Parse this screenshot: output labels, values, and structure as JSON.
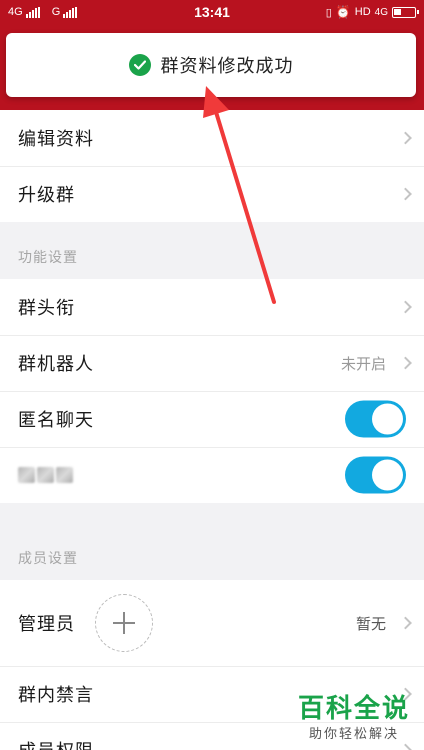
{
  "status_bar": {
    "sim1": "4G",
    "sim2": "G",
    "time": "13:41",
    "right_label": "HD",
    "right_net": "4G"
  },
  "toast": {
    "text": "群资料修改成功",
    "icon": "check-circle-icon"
  },
  "profile_section": {
    "items": [
      {
        "label": "编辑资料"
      },
      {
        "label": "升级群"
      }
    ]
  },
  "function_section": {
    "title": "功能设置",
    "items": [
      {
        "label": "群头衔",
        "value": ""
      },
      {
        "label": "群机器人",
        "value": "未开启"
      },
      {
        "label": "匿名聊天",
        "toggle_on": true
      },
      {
        "label": "",
        "toggle_on": true
      }
    ]
  },
  "member_section": {
    "title": "成员设置",
    "items": [
      {
        "label": "管理员",
        "value": "暂无"
      },
      {
        "label": "群内禁言"
      },
      {
        "label": "成员权限"
      }
    ]
  },
  "watermark": {
    "main": "百科全说",
    "sub": "助你轻松解决"
  },
  "colors": {
    "brand_red": "#b8121f",
    "toggle_blue": "#12a9e0",
    "success_green": "#1aa34a"
  }
}
